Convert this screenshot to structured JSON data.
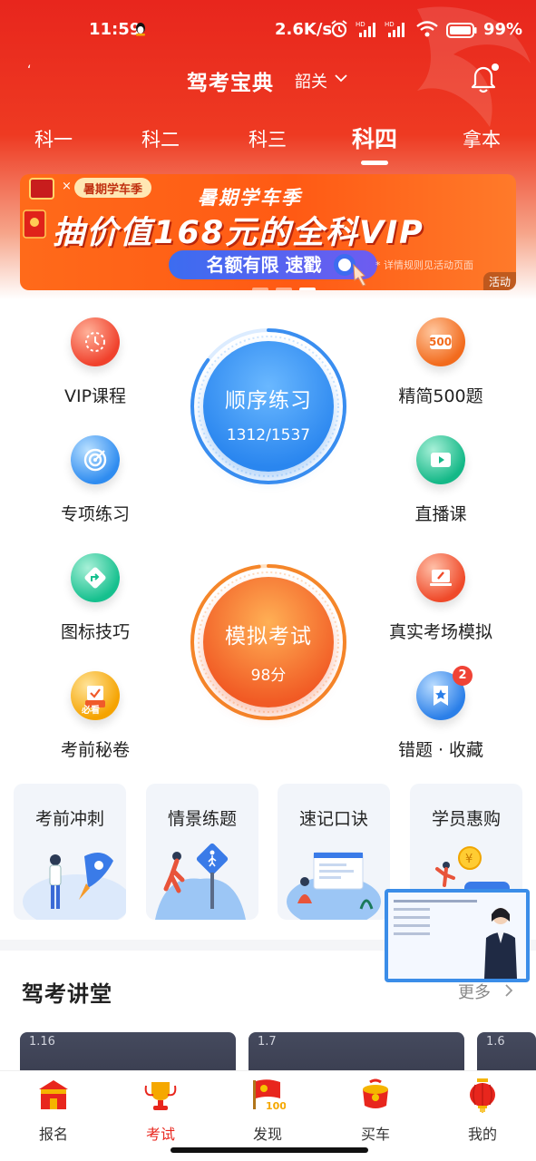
{
  "status_bar": {
    "time": "11:59",
    "net_speed": "2.6K/s",
    "battery": "99%"
  },
  "header": {
    "back": "‘",
    "title": "驾考宝典",
    "city": "韶关"
  },
  "tabs": [
    "科一",
    "科二",
    "科三",
    "科四",
    "拿本"
  ],
  "active_tab": "科四",
  "banner": {
    "tag": "暑期学车季",
    "headline": "暑期学车季",
    "main_text": "抽价值168元的全科VIP",
    "cta": "名额有限 速戳",
    "fine_print": "* 详情规则见活动页面",
    "corner": "活动"
  },
  "features": {
    "vip": "VIP课程",
    "special": "专项练习",
    "signs": "图标技巧",
    "secret": "考前秘卷",
    "secret_badge": "必看",
    "q500": "精简500题",
    "q500_badge": "500",
    "live": "直播课",
    "real_exam": "真实考场模拟",
    "mistakes": "错题 · 收藏",
    "mistakes_count": "2"
  },
  "sequence_practice": {
    "label": "顺序练习",
    "progress_text": "1312/1537",
    "done": 1312,
    "total": 1537
  },
  "mock_exam": {
    "label": "模拟考试",
    "score_text": "98分",
    "score": 98
  },
  "quick_cards": [
    "考前冲刺",
    "情景练题",
    "速记口诀",
    "学员惠购"
  ],
  "lecture_section": {
    "title": "驾考讲堂",
    "more": "更多",
    "items": [
      "1.16",
      "1.7",
      "1.6"
    ]
  },
  "bottom_nav": [
    {
      "label": "报名",
      "active": false
    },
    {
      "label": "考试",
      "active": true
    },
    {
      "label": "发现",
      "active": false
    },
    {
      "label": "买车",
      "active": false
    },
    {
      "label": "我的",
      "active": false
    }
  ],
  "colors": {
    "brand_red": "#e8261d",
    "blue_ring": "#3a8ef0",
    "orange_ring": "#f5862a",
    "banner_orange": "#ff5a14"
  },
  "icons": [
    "qq-penguin-icon",
    "alarm-icon",
    "signal-icon",
    "wifi-icon",
    "battery-icon",
    "chevron-down-icon",
    "bell-icon",
    "red-envelope-icon",
    "hand-pointer-icon",
    "clock-icon",
    "target-icon",
    "sign-arrow-icon",
    "clipboard-check-icon",
    "badge-500-icon",
    "video-play-icon",
    "laptop-pen-icon",
    "star-bookmark-icon",
    "chevron-right-icon",
    "gate-icon",
    "trophy-icon",
    "flag-icon",
    "gift-box-icon",
    "lantern-icon"
  ]
}
